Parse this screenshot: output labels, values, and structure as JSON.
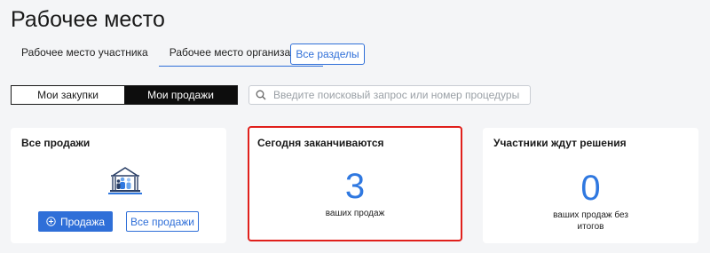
{
  "page": {
    "title": "Рабочее место"
  },
  "tabs": [
    {
      "label": "Рабочее место участника",
      "active": false
    },
    {
      "label": "Рабочее место организатора",
      "active": true
    }
  ],
  "all_sections_label": "Все разделы",
  "segment": [
    {
      "label": "Мои закупки",
      "active": false
    },
    {
      "label": "Мои продажи",
      "active": true
    }
  ],
  "search": {
    "placeholder": "Введите поисковый запрос или номер процедуры",
    "value": ""
  },
  "cards": {
    "all_sales": {
      "title": "Все продажи",
      "illustration_icon": "building-people-icon",
      "primary_button": {
        "icon": "plus-circle-icon",
        "label": "Продажа"
      },
      "secondary_button": {
        "label": "Все продажи"
      }
    },
    "ending_today": {
      "title": "Сегодня заканчиваются",
      "count": "3",
      "caption": "ваших продаж",
      "highlight_color": "#e0201c"
    },
    "awaiting_decision": {
      "title": "Участники ждут решения",
      "count": "0",
      "caption": "ваших продаж без итогов"
    }
  },
  "colors": {
    "accent": "#2f6fd8",
    "number": "#2f78e0",
    "background": "#f4f5f7"
  }
}
